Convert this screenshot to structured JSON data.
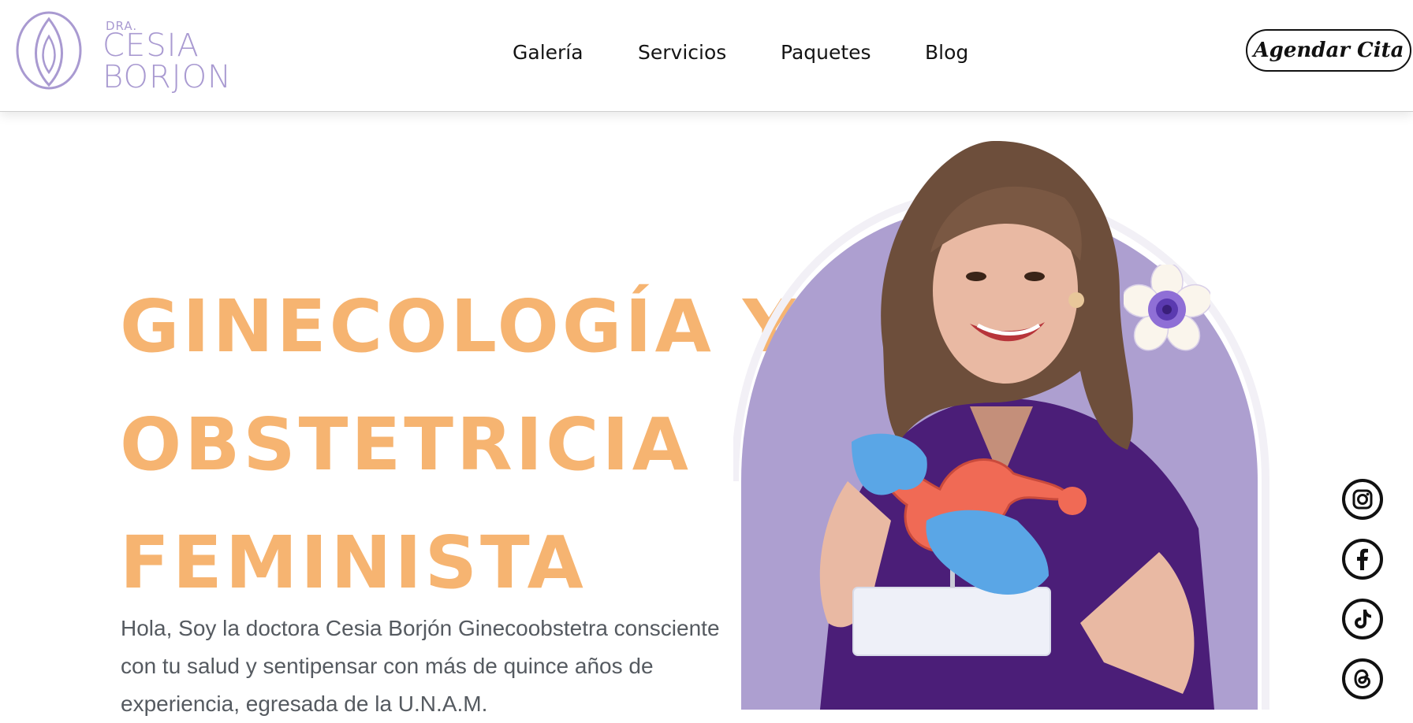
{
  "header": {
    "logo": {
      "prefix": "DRA.",
      "line1": "CESIA",
      "line2": "BORJON"
    },
    "nav": [
      {
        "label": "Galería"
      },
      {
        "label": "Servicios"
      },
      {
        "label": "Paquetes"
      },
      {
        "label": "Blog"
      }
    ],
    "cta_label": "Agendar Cita"
  },
  "hero": {
    "title_lines": [
      "GINECOLOGÍA Y",
      "OBSTETRICIA",
      "FEMINISTA"
    ],
    "body": "Hola, Soy la doctora Cesia Borjón Ginecoobstetra consciente con tu salud y sentipensar con más de quince años de experiencia, egresada de la U.N.A.M."
  },
  "social": [
    "instagram-icon",
    "facebook-icon",
    "tiktok-icon",
    "threads-icon"
  ],
  "colors": {
    "accent_orange": "#f6b471",
    "logo_lavender": "#a99ad1",
    "portrait_bg": "#ad9fd0",
    "scrubs_purple": "#4b1e78",
    "glove_blue": "#5aa6e6"
  }
}
